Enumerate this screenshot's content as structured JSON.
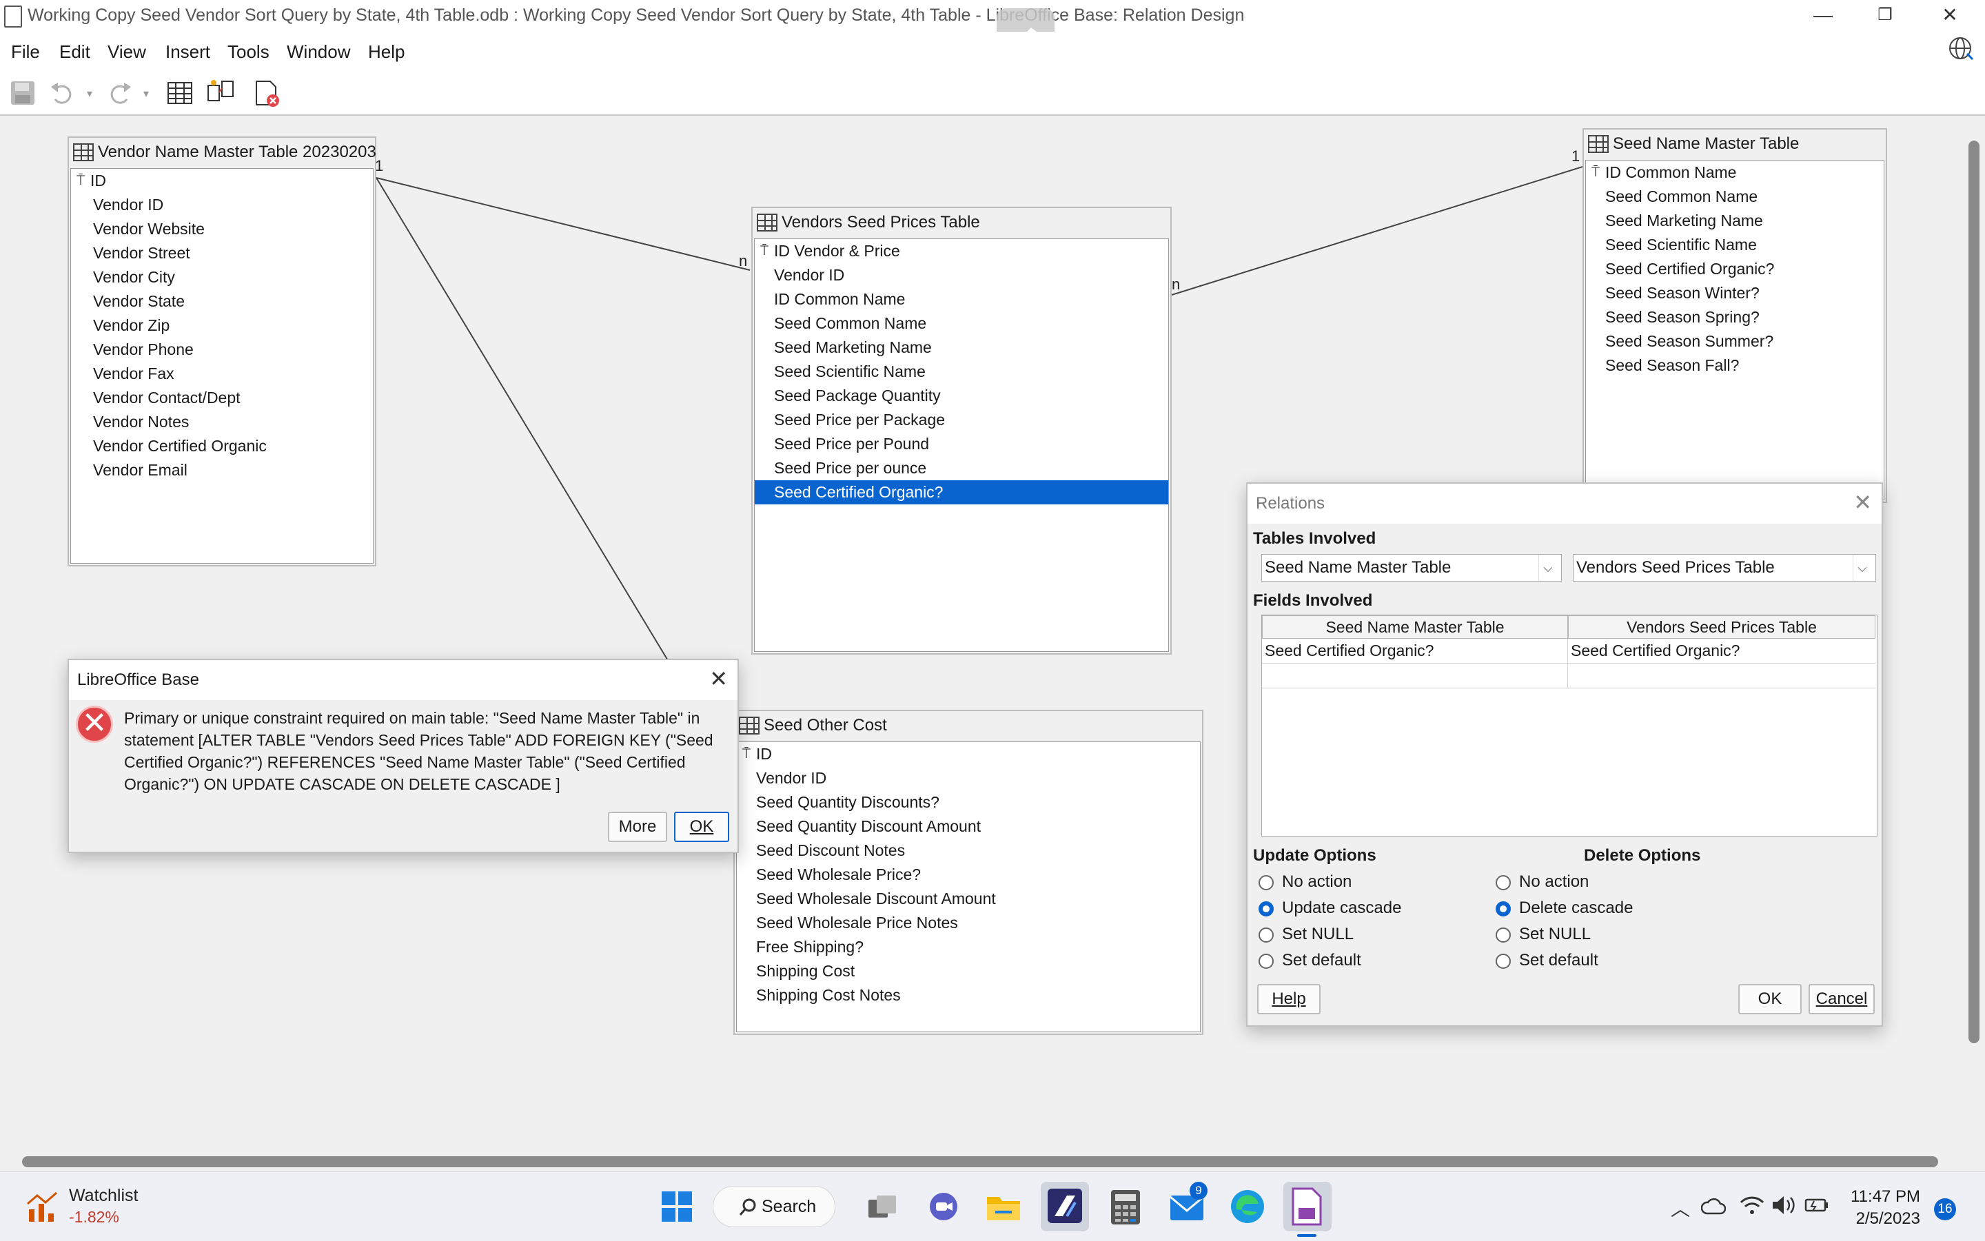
{
  "window": {
    "title": "Working Copy Seed Vendor Sort Query by State, 4th Table.odb : Working Copy Seed Vendor Sort Query by State, 4th Table - LibreOffice Base: Relation Design",
    "minimize": "—",
    "maximize": "❐",
    "close": "✕"
  },
  "menu": [
    "File",
    "Edit",
    "View",
    "Insert",
    "Tools",
    "Window",
    "Help"
  ],
  "tables": {
    "vendor": {
      "name": "Vendor Name Master Table 20230203",
      "fields": [
        "ID",
        "Vendor ID",
        "Vendor Website",
        "Vendor Street",
        "Vendor City",
        "Vendor State",
        "Vendor Zip",
        "Vendor Phone",
        "Vendor Fax",
        "Vendor Contact/Dept",
        "Vendor Notes",
        "Vendor Certified Organic",
        "Vendor Email"
      ]
    },
    "prices": {
      "name": "Vendors Seed Prices Table",
      "fields": [
        "ID Vendor & Price",
        "Vendor ID",
        "ID Common Name",
        "Seed Common Name",
        "Seed Marketing Name",
        "Seed Scientific Name",
        "Seed Package Quantity",
        "Seed Price per Package",
        "Seed Price per Pound",
        "Seed Price per ounce",
        "Seed Certified Organic?"
      ],
      "selected_index": 10
    },
    "seed": {
      "name": "Seed Name Master Table",
      "fields": [
        "ID Common Name",
        "Seed Common Name",
        "Seed Marketing Name",
        "Seed Scientific Name",
        "Seed Certified Organic?",
        "Seed Season Winter?",
        "Seed Season Spring?",
        "Seed Season Summer?",
        "Seed Season Fall?"
      ]
    },
    "other": {
      "name": "Seed Other Cost",
      "fields": [
        "ID",
        "Vendor ID",
        "Seed Quantity Discounts?",
        "Seed Quantity Discount Amount",
        "Seed Discount Notes",
        "Seed Wholesale Price?",
        "Seed Wholesale Discount Amount",
        "Seed Wholesale Price Notes",
        "Free Shipping?",
        "Shipping Cost",
        "Shipping Cost Notes"
      ]
    }
  },
  "relation_labels": {
    "one_a": "1",
    "n_a": "n",
    "one_b": "1",
    "n_b": "n"
  },
  "error_dialog": {
    "title": "LibreOffice Base",
    "message": "Primary or unique constraint required on main table: \"Seed Name Master Table\" in statement [ALTER TABLE \"Vendors Seed Prices Table\" ADD  FOREIGN KEY (\"Seed Certified Organic?\") REFERENCES \"Seed Name Master Table\" (\"Seed Certified Organic?\") ON UPDATE CASCADE  ON DELETE CASCADE ]",
    "more": "More",
    "ok": "OK"
  },
  "relations_dialog": {
    "title": "Relations",
    "tables_involved": "Tables Involved",
    "left_table": "Seed Name Master Table",
    "right_table": "Vendors Seed Prices Table",
    "fields_involved": "Fields Involved",
    "col_left": "Seed Name Master Table",
    "col_right": "Vendors Seed Prices Table",
    "row_left": "Seed Certified Organic?",
    "row_right": "Seed Certified Organic?",
    "update_options": "Update Options",
    "delete_options": "Delete Options",
    "update": [
      "No action",
      "Update cascade",
      "Set NULL",
      "Set default"
    ],
    "delete": [
      "No action",
      "Delete cascade",
      "Set NULL",
      "Set default"
    ],
    "update_selected": 1,
    "delete_selected": 1,
    "help": "Help",
    "ok": "OK",
    "cancel": "Cancel"
  },
  "taskbar": {
    "watchlist_title": "Watchlist",
    "watchlist_value": "-1.82%",
    "search": "Search",
    "mail_badge": "9",
    "time": "11:47 PM",
    "date": "2/5/2023",
    "notifications": "16"
  }
}
